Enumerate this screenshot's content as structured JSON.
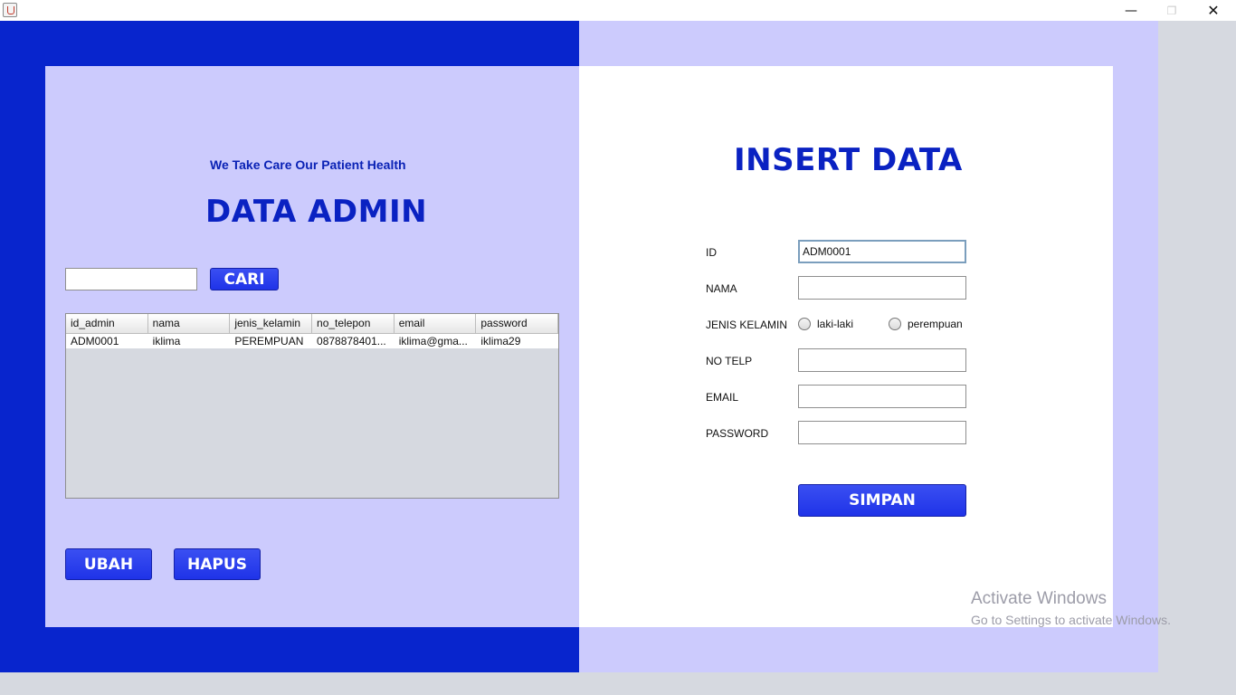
{
  "window": {
    "minimize": "—",
    "maximize": "❐",
    "close": "✕"
  },
  "left": {
    "tagline": "We Take Care Our Patient Health",
    "title": "DATA ADMIN",
    "search": {
      "value": "",
      "button": "CARI"
    },
    "table": {
      "columns": [
        "id_admin",
        "nama",
        "jenis_kelamin",
        "no_telepon",
        "email",
        "password"
      ],
      "rows": [
        [
          "ADM0001",
          "iklima",
          "PEREMPUAN",
          "0878878401...",
          "iklima@gma...",
          "iklima29"
        ]
      ]
    },
    "buttons": {
      "edit": "UBAH",
      "delete": "HAPUS"
    }
  },
  "right": {
    "title": "INSERT DATA",
    "fields": {
      "id": {
        "label": "ID",
        "value": "ADM0001"
      },
      "nama": {
        "label": "NAMA",
        "value": ""
      },
      "gender": {
        "label": "JENIS KELAMIN",
        "options": [
          "laki-laki",
          "perempuan"
        ]
      },
      "telp": {
        "label": "NO TELP",
        "value": ""
      },
      "email": {
        "label": "EMAIL",
        "value": ""
      },
      "password": {
        "label": "PASSWORD",
        "value": ""
      }
    },
    "submit": "SIMPAN"
  },
  "watermark": {
    "line1": "Activate Windows",
    "line2": "Go to Settings to activate Windows."
  },
  "colors": {
    "primary": "#0825cd",
    "panel": "#cccbfd",
    "button": "#1f33e8",
    "title": "#0a22c2"
  }
}
